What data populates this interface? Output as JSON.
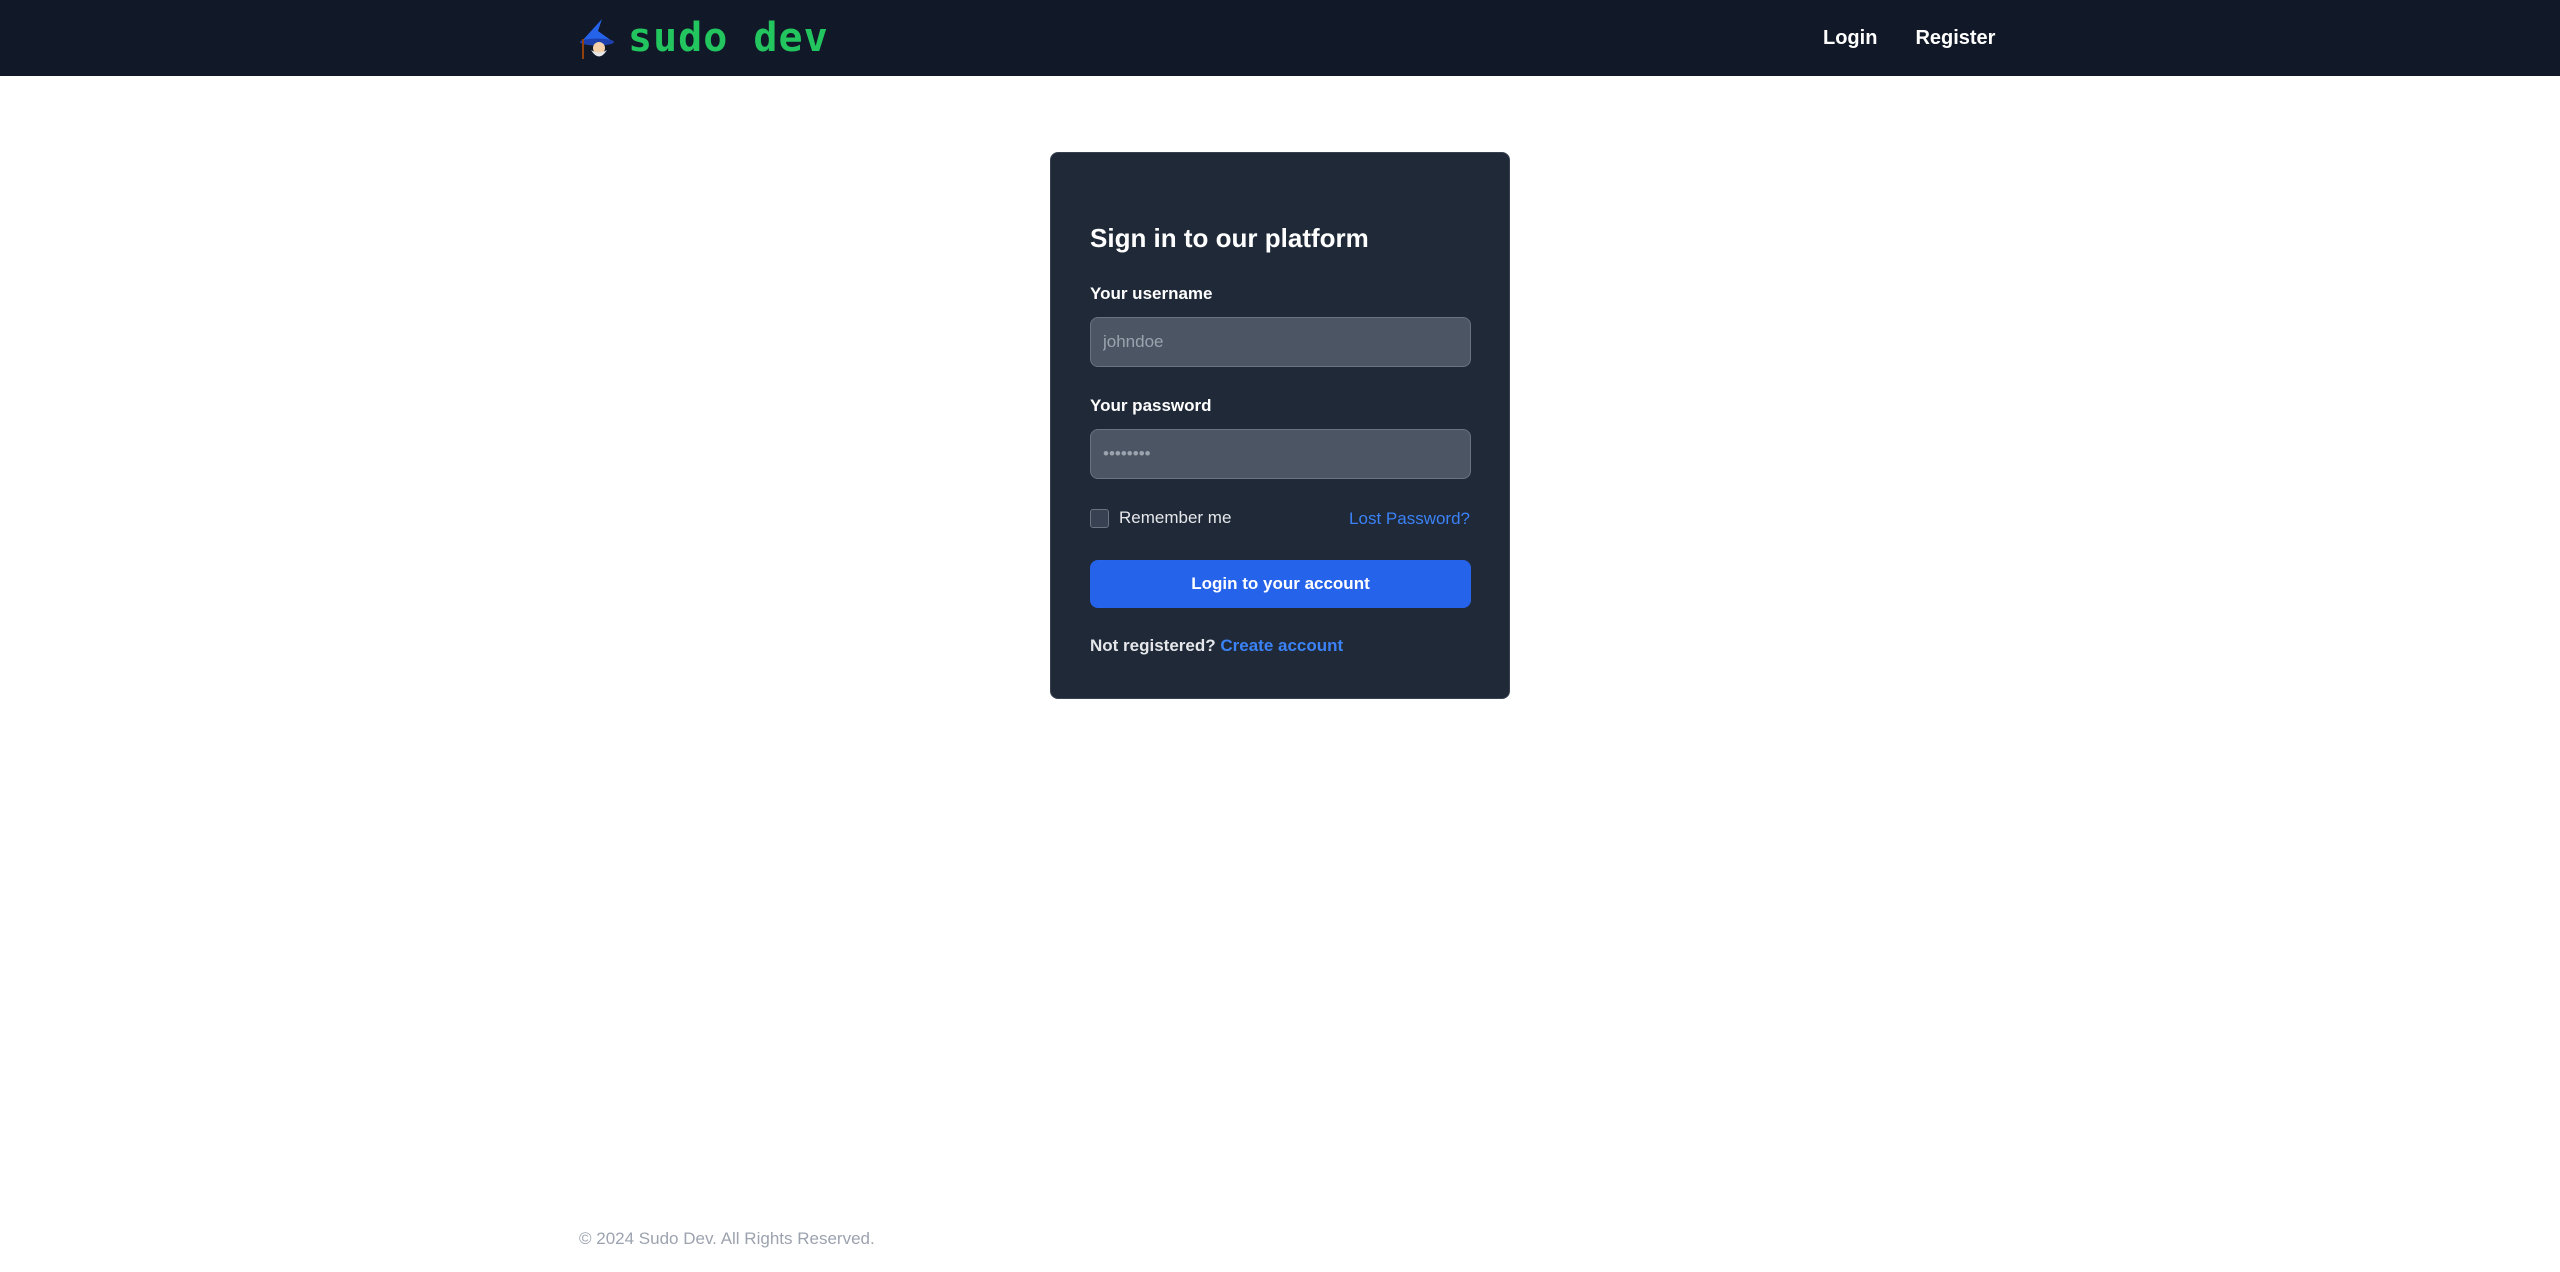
{
  "navbar": {
    "brand": "sudo dev",
    "brand_icon": "wizard-icon",
    "links": [
      {
        "label": "Login"
      },
      {
        "label": "Register"
      }
    ]
  },
  "login_card": {
    "title": "Sign in to our platform",
    "username_label": "Your username",
    "username_placeholder": "johndoe",
    "username_value": "",
    "password_label": "Your password",
    "password_placeholder": "••••••••",
    "password_value": "",
    "remember_label": "Remember me",
    "remember_checked": false,
    "lost_password": "Lost Password?",
    "submit_label": "Login to your account",
    "not_registered": "Not registered?",
    "create_account": "Create account"
  },
  "footer": {
    "text": "© 2024 Sudo Dev. All Rights Reserved."
  },
  "colors": {
    "navbar_bg": "#111827",
    "brand": "#22c55e",
    "card_bg": "#1f2937",
    "primary": "#2563eb",
    "link": "#3b82f6"
  }
}
